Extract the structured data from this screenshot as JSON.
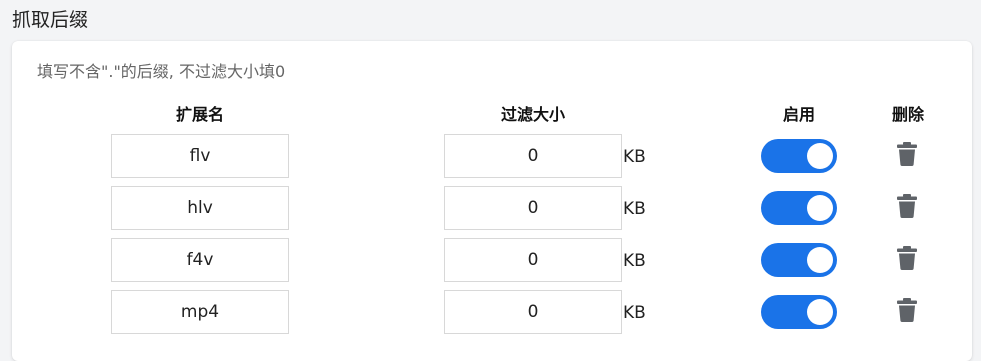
{
  "section": {
    "title": "抓取后缀"
  },
  "panel": {
    "hint": "填写不含\".\"的后缀, 不过滤大小填0",
    "headers": {
      "extension": "扩展名",
      "filter_size": "过滤大小",
      "enable": "启用",
      "delete": "删除"
    },
    "rows": [
      {
        "extension": "flv",
        "size": "0",
        "unit": "KB",
        "enabled": true,
        "delete_icon": "trash-icon"
      },
      {
        "extension": "hlv",
        "size": "0",
        "unit": "KB",
        "enabled": true,
        "delete_icon": "trash-icon"
      },
      {
        "extension": "f4v",
        "size": "0",
        "unit": "KB",
        "enabled": true,
        "delete_icon": "trash-icon"
      },
      {
        "extension": "mp4",
        "size": "0",
        "unit": "KB",
        "enabled": true,
        "delete_icon": "trash-icon"
      }
    ]
  },
  "colors": {
    "accent": "#1a73e8",
    "icon": "#5f6368",
    "background": "#f3f4f6"
  }
}
